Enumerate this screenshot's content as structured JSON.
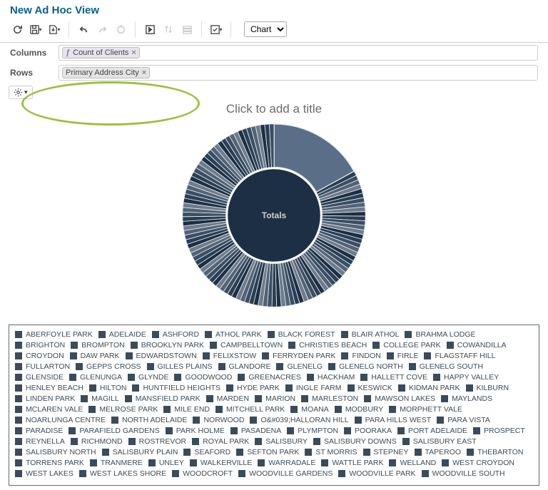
{
  "header": {
    "title": "New Ad Hoc View"
  },
  "toolbar": {
    "chart_select": "Chart"
  },
  "columns": {
    "label": "Columns",
    "chip": "Count of Clients"
  },
  "rows": {
    "label": "Rows",
    "chip": "Primary Address City"
  },
  "chart": {
    "title_placeholder": "Click to add a title",
    "center_label": "Totals"
  },
  "chart_data": {
    "type": "pie",
    "title": "Totals",
    "note": "Approximate share of client count by primary address city. One slice dominates (~15-18%); many small slices.",
    "categories_reference": "legend.items",
    "series": [
      {
        "name": "Count of Clients",
        "values_note": "Largest slice ≈ 17% of total; next few ≈ 3-5% each; remaining ~80+ categories are thin slices."
      }
    ]
  },
  "legend": {
    "items": [
      "ABERFOYLE PARK",
      "ADELAIDE",
      "ASHFORD",
      "ATHOL PARK",
      "BLACK FOREST",
      "BLAIR ATHOL",
      "BRAHMA LODGE",
      "BRIGHTON",
      "BROMPTON",
      "BROOKLYN PARK",
      "CAMPBELLTOWN",
      "CHRISTIES BEACH",
      "COLLEGE PARK",
      "COWANDILLA",
      "CROYDON",
      "DAW PARK",
      "EDWARDSTOWN",
      "FELIXSTOW",
      "FERRYDEN PARK",
      "FINDON",
      "FIRLE",
      "FLAGSTAFF HILL",
      "FULLARTON",
      "GEPPS CROSS",
      "GILLES PLAINS",
      "GLANDORE",
      "GLENELG",
      "GLENELG NORTH",
      "GLENELG SOUTH",
      "GLENSIDE",
      "GLENUNGA",
      "GLYNDE",
      "GOODWOOD",
      "GREENACRES",
      "HACKHAM",
      "HALLETT COVE",
      "HAPPY VALLEY",
      "HENLEY BEACH",
      "HILTON",
      "HUNTFIELD HEIGHTS",
      "HYDE PARK",
      "INGLE FARM",
      "KESWICK",
      "KIDMAN PARK",
      "KILBURN",
      "LINDEN PARK",
      "MAGILL",
      "MANSFIELD PARK",
      "MARDEN",
      "MARION",
      "MARLESTON",
      "MAWSON LAKES",
      "MAYLANDS",
      "MCLAREN VALE",
      "MELROSE PARK",
      "MILE END",
      "MITCHELL PARK",
      "MOANA",
      "MODBURY",
      "MORPHETT VALE",
      "NOARLUNGA CENTRE",
      "NORTH ADELAIDE",
      "NORWOOD",
      "O&#039;HALLORAN HILL",
      "PARA HILLS WEST",
      "PARA VISTA",
      "PARADISE",
      "PARAFIELD GARDENS",
      "PARK HOLME",
      "PASADENA",
      "PLYMPTON",
      "POORAKA",
      "PORT ADELAIDE",
      "PROSPECT",
      "REYNELLA",
      "RICHMOND",
      "ROSTREVOR",
      "ROYAL PARK",
      "SALISBURY",
      "SALISBURY DOWNS",
      "SALISBURY EAST",
      "SALISBURY NORTH",
      "SALISBURY PLAIN",
      "SEAFORD",
      "SEFTON PARK",
      "ST MORRIS",
      "STEPNEY",
      "TAPEROO",
      "THEBARTON",
      "TORRENS PARK",
      "TRANMERE",
      "UNLEY",
      "WALKERVILLE",
      "WARRADALE",
      "WATTLE PARK",
      "WELLAND",
      "WEST CROYDON",
      "WEST LAKES",
      "WEST LAKES SHORE",
      "WOODCROFT",
      "WOODVILLE GARDENS",
      "WOODVILLE PARK",
      "WOODVILLE SOUTH"
    ]
  }
}
